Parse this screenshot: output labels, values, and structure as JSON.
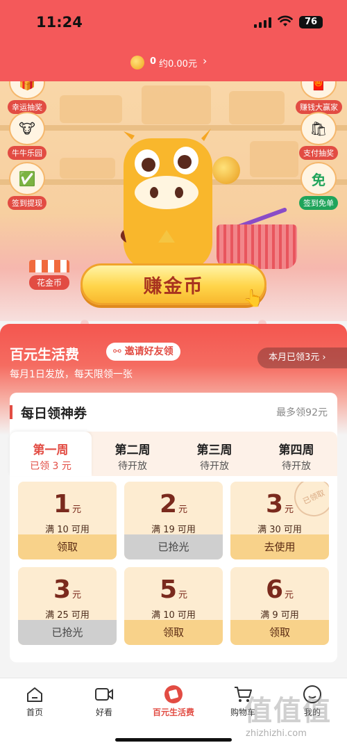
{
  "status_bar": {
    "time": "11:24",
    "battery": "76"
  },
  "coins": {
    "count": "0",
    "approx": "约0.00元",
    "arrow": "›"
  },
  "hero": {
    "left_buttons": [
      {
        "label": "幸运抽奖",
        "icon": "gift-icon"
      },
      {
        "label": "牛牛乐园",
        "icon": "cow-face-icon"
      },
      {
        "label": "签到提现",
        "icon": "calendar-check-icon"
      }
    ],
    "right_buttons": [
      {
        "label": "赚钱大赢家",
        "icon": "red-envelope-icon"
      },
      {
        "label": "支付抽奖",
        "icon": "shopping-bag-icon"
      },
      {
        "label": "签到免单",
        "icon": "free-receipt-icon",
        "icon_text": "免"
      }
    ],
    "flower_shop_label": "花金币",
    "earn_button": "赚金币"
  },
  "main": {
    "title": "百元生活费",
    "invite_label": "邀请好友领",
    "subtitle": "每月1日发放，每天限领一张",
    "month_claimed": "本月已领3元 ›"
  },
  "daily_coupons": {
    "title": "每日领神券",
    "max_label": "最多领92元",
    "tabs": [
      {
        "week": "第一周",
        "status": "已领 3 元",
        "active": true
      },
      {
        "week": "第二周",
        "status": "待开放",
        "active": false
      },
      {
        "week": "第三周",
        "status": "待开放",
        "active": false
      },
      {
        "week": "第四周",
        "status": "待开放",
        "active": false
      }
    ],
    "unit": "元",
    "coupons": [
      {
        "amount": "1",
        "condition": "满 10 可用",
        "action": "领取",
        "state": "available"
      },
      {
        "amount": "2",
        "condition": "满 19 可用",
        "action": "已抢光",
        "state": "sold-out"
      },
      {
        "amount": "3",
        "condition": "满 30 可用",
        "action": "去使用",
        "state": "claimed",
        "stamp": "已领取"
      },
      {
        "amount": "3",
        "condition": "满 25 可用",
        "action": "已抢光",
        "state": "sold-out"
      },
      {
        "amount": "5",
        "condition": "满 10 可用",
        "action": "领取",
        "state": "available"
      },
      {
        "amount": "6",
        "condition": "满 9 可用",
        "action": "领取",
        "state": "available"
      }
    ]
  },
  "bottom_nav": [
    {
      "label": "首页",
      "icon": "home-icon",
      "active": false
    },
    {
      "label": "好看",
      "icon": "video-icon",
      "active": false
    },
    {
      "label": "百元生活费",
      "icon": "coupon-badge-icon",
      "active": true
    },
    {
      "label": "购物车",
      "icon": "cart-icon",
      "active": false
    },
    {
      "label": "我的",
      "icon": "profile-icon",
      "active": false
    }
  ],
  "watermark": {
    "text": "值值值",
    "url": "zhizhizhi.com"
  },
  "colors": {
    "brand_red": "#e24c43",
    "header_red": "#f4595a",
    "coupon_bg": "#fdecd1",
    "action_yellow": "#f8d28a"
  }
}
